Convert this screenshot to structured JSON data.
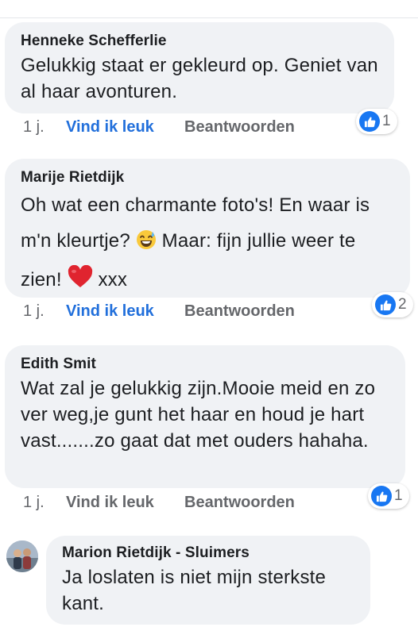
{
  "comments": [
    {
      "author": "Henneke Schefferlie",
      "text": "Gelukkig staat er gekleurd op. Geniet van al haar avonturen.",
      "time": "1 j.",
      "like_label": "Vind ik leuk",
      "reply_label": "Beantwoorden",
      "reaction_count": "1"
    },
    {
      "author": "Marije Rietdijk",
      "text_part1": "Oh wat een charmante foto's! En waar is m'n kleurtje?",
      "emoji1": "sweat-smile-emoji",
      "text_part2": "Maar: fijn jullie weer te zien!",
      "emoji2": "red-heart-emoji",
      "text_part3": "xxx",
      "time": "1 j.",
      "like_label": "Vind ik leuk",
      "reply_label": "Beantwoorden",
      "reaction_count": "2"
    },
    {
      "author": "Edith Smit",
      "text": "Wat zal je gelukkig zijn.Mooie meid en zo ver weg,je gunt het haar en houd je hart vast.......zo gaat dat met ouders hahaha.",
      "time": "1 j.",
      "like_label": "Vind ik leuk",
      "reply_label": "Beantwoorden",
      "reaction_count": "1"
    }
  ],
  "reply": {
    "author": "Marion Rietdijk - Sluimers",
    "text": "Ja loslaten is niet mijn sterkste kant."
  },
  "colors": {
    "bubble_bg": "#f0f2f5",
    "link_blue": "#216fdb",
    "muted": "#65676b",
    "reaction_blue": "#1877f2"
  }
}
